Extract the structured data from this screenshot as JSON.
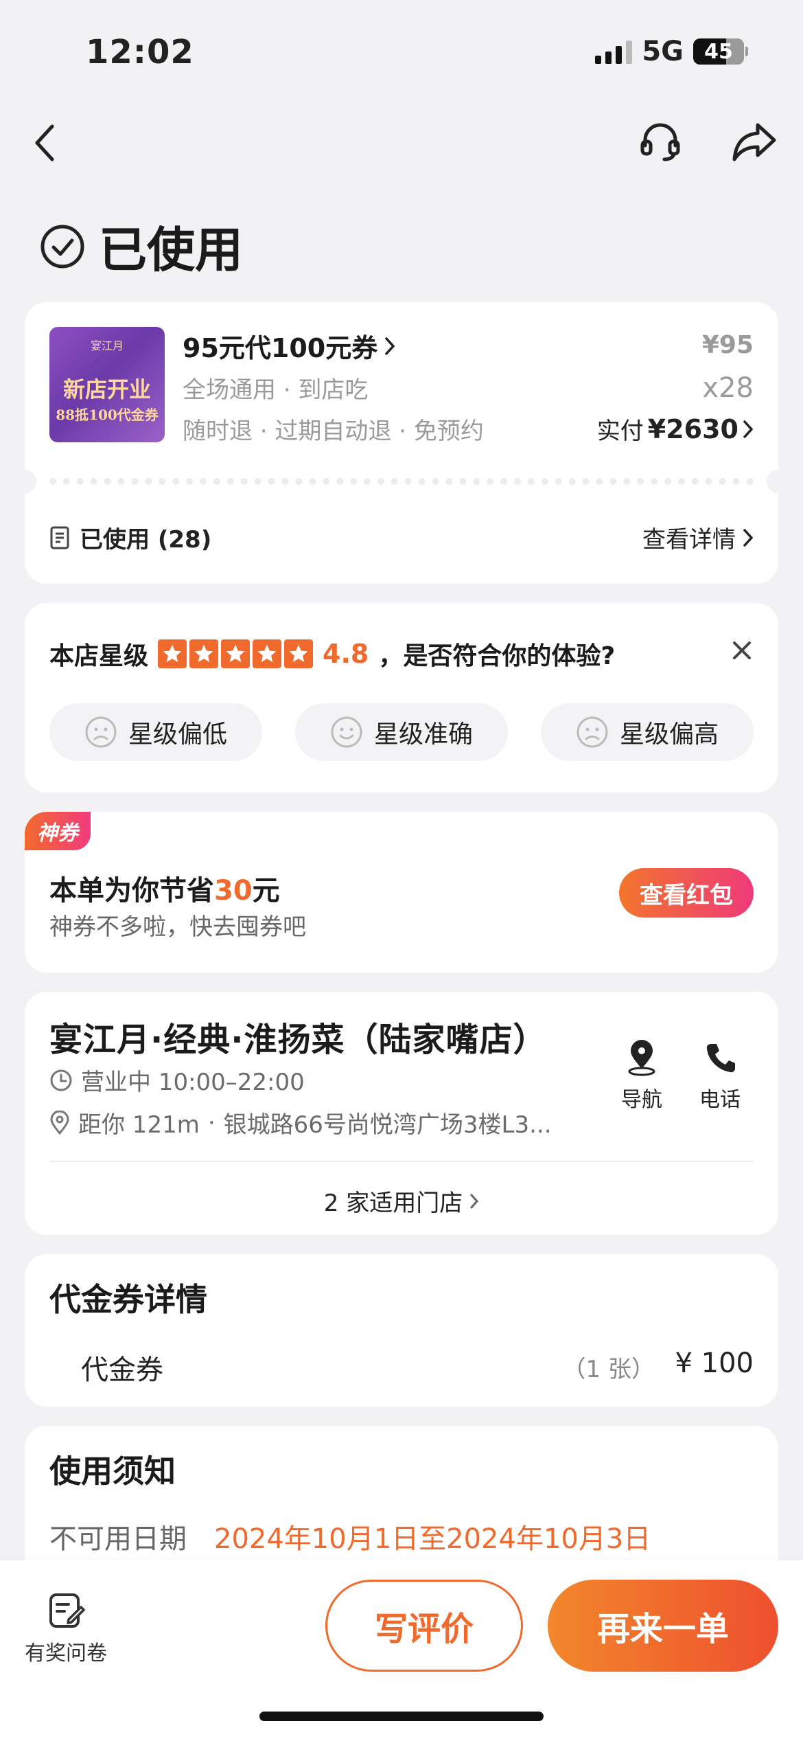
{
  "status_bar": {
    "time": "12:02",
    "network": "5G",
    "battery": "45"
  },
  "header": {
    "status_title": "已使用"
  },
  "order": {
    "image_top": "宴江月",
    "image_main": "新店开业",
    "image_sub": "88抵100代金券",
    "name": "95元代100元券",
    "line1": "全场通用 · 到店吃",
    "line2": "随时退 · 过期自动退 · 免预约",
    "price": "¥95",
    "quantity": "x28",
    "paid_label": "实付",
    "paid_amount": "¥2630",
    "used_label": "已使用 (28)",
    "view_detail": "查看详情"
  },
  "rating": {
    "label": "本店星级",
    "stars": 5,
    "score": "4.8",
    "question": "，是否符合你的体验?",
    "options": [
      "星级偏低",
      "星级准确",
      "星级偏高"
    ]
  },
  "promo": {
    "tag": "神券",
    "text_prefix": "本单为你节省",
    "amount": "30",
    "text_suffix": "元",
    "sub": "神券不多啦，快去囤券吧",
    "button": "查看红包"
  },
  "store": {
    "name": "宴江月·经典·淮扬菜（陆家嘴店）",
    "hours": "营业中 10:00–22:00",
    "distance": "距你 121m",
    "address": "银城路66号尚悦湾广场3楼L3...",
    "nav_label": "导航",
    "phone_label": "电话",
    "stores_link": "2 家适用门店"
  },
  "voucher": {
    "title": "代金券详情",
    "item": "代金券",
    "count": "（1 张）",
    "value": "¥ 100"
  },
  "notice": {
    "title": "使用须知",
    "label": "不可用日期",
    "dates": "2024年10月1日至2024年10月3日"
  },
  "bottom": {
    "survey": "有奖问卷",
    "review": "写评价",
    "again": "再来一单"
  },
  "colors": {
    "accent": "#f16a2d",
    "pink": "#ef3a7a",
    "background": "#f2f2f5"
  }
}
